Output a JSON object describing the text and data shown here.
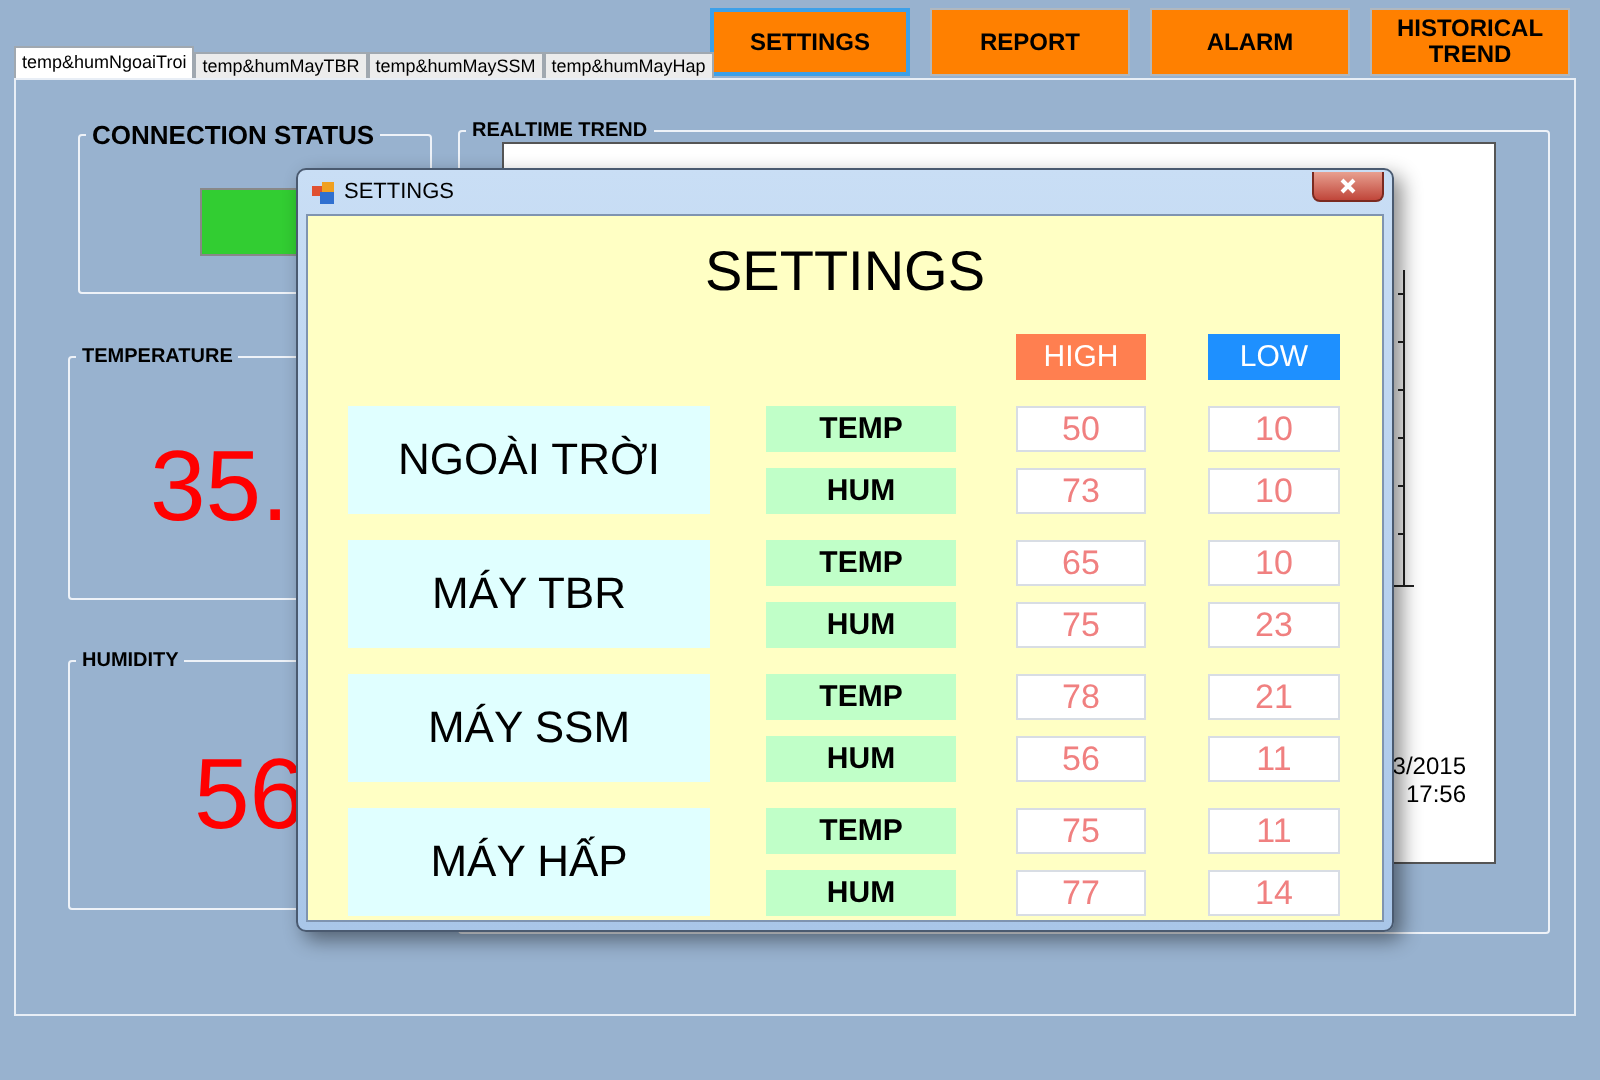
{
  "toolbar_buttons": [
    {
      "label": "SETTINGS",
      "selected": true
    },
    {
      "label": "REPORT",
      "selected": false
    },
    {
      "label": "ALARM",
      "selected": false
    },
    {
      "label": "HISTORICAL TREND",
      "selected": false
    }
  ],
  "tabs": [
    {
      "label": "temp&humNgoaiTroi",
      "selected": true
    },
    {
      "label": "temp&humMayTBR",
      "selected": false
    },
    {
      "label": "temp&humMaySSM",
      "selected": false
    },
    {
      "label": "temp&humMayHap",
      "selected": false
    }
  ],
  "connection_status": {
    "title": "CONNECTION STATUS",
    "connected": true
  },
  "temperature": {
    "title": "TEMPERATURE",
    "value": "35."
  },
  "humidity": {
    "title": "HUMIDITY",
    "value": "56"
  },
  "realtime_trend": {
    "title": "REALTIME TREND",
    "axis_labels": [
      "3/2015",
      "17:56"
    ]
  },
  "settings_dialog": {
    "title": "SETTINGS",
    "heading": "SETTINGS",
    "columns": [
      "HIGH",
      "LOW"
    ],
    "groups": [
      {
        "name": "NGOÀI TRỜI",
        "rows": [
          {
            "label": "TEMP",
            "high": "50",
            "low": "10"
          },
          {
            "label": "HUM",
            "high": "73",
            "low": "10"
          }
        ]
      },
      {
        "name": "MÁY TBR",
        "rows": [
          {
            "label": "TEMP",
            "high": "65",
            "low": "10"
          },
          {
            "label": "HUM",
            "high": "75",
            "low": "23"
          }
        ]
      },
      {
        "name": "MÁY SSM",
        "rows": [
          {
            "label": "TEMP",
            "high": "78",
            "low": "21"
          },
          {
            "label": "HUM",
            "high": "56",
            "low": "11"
          }
        ]
      },
      {
        "name": "MÁY HẤP",
        "rows": [
          {
            "label": "TEMP",
            "high": "75",
            "low": "11"
          },
          {
            "label": "HUM",
            "high": "77",
            "low": "14"
          }
        ]
      }
    ]
  }
}
